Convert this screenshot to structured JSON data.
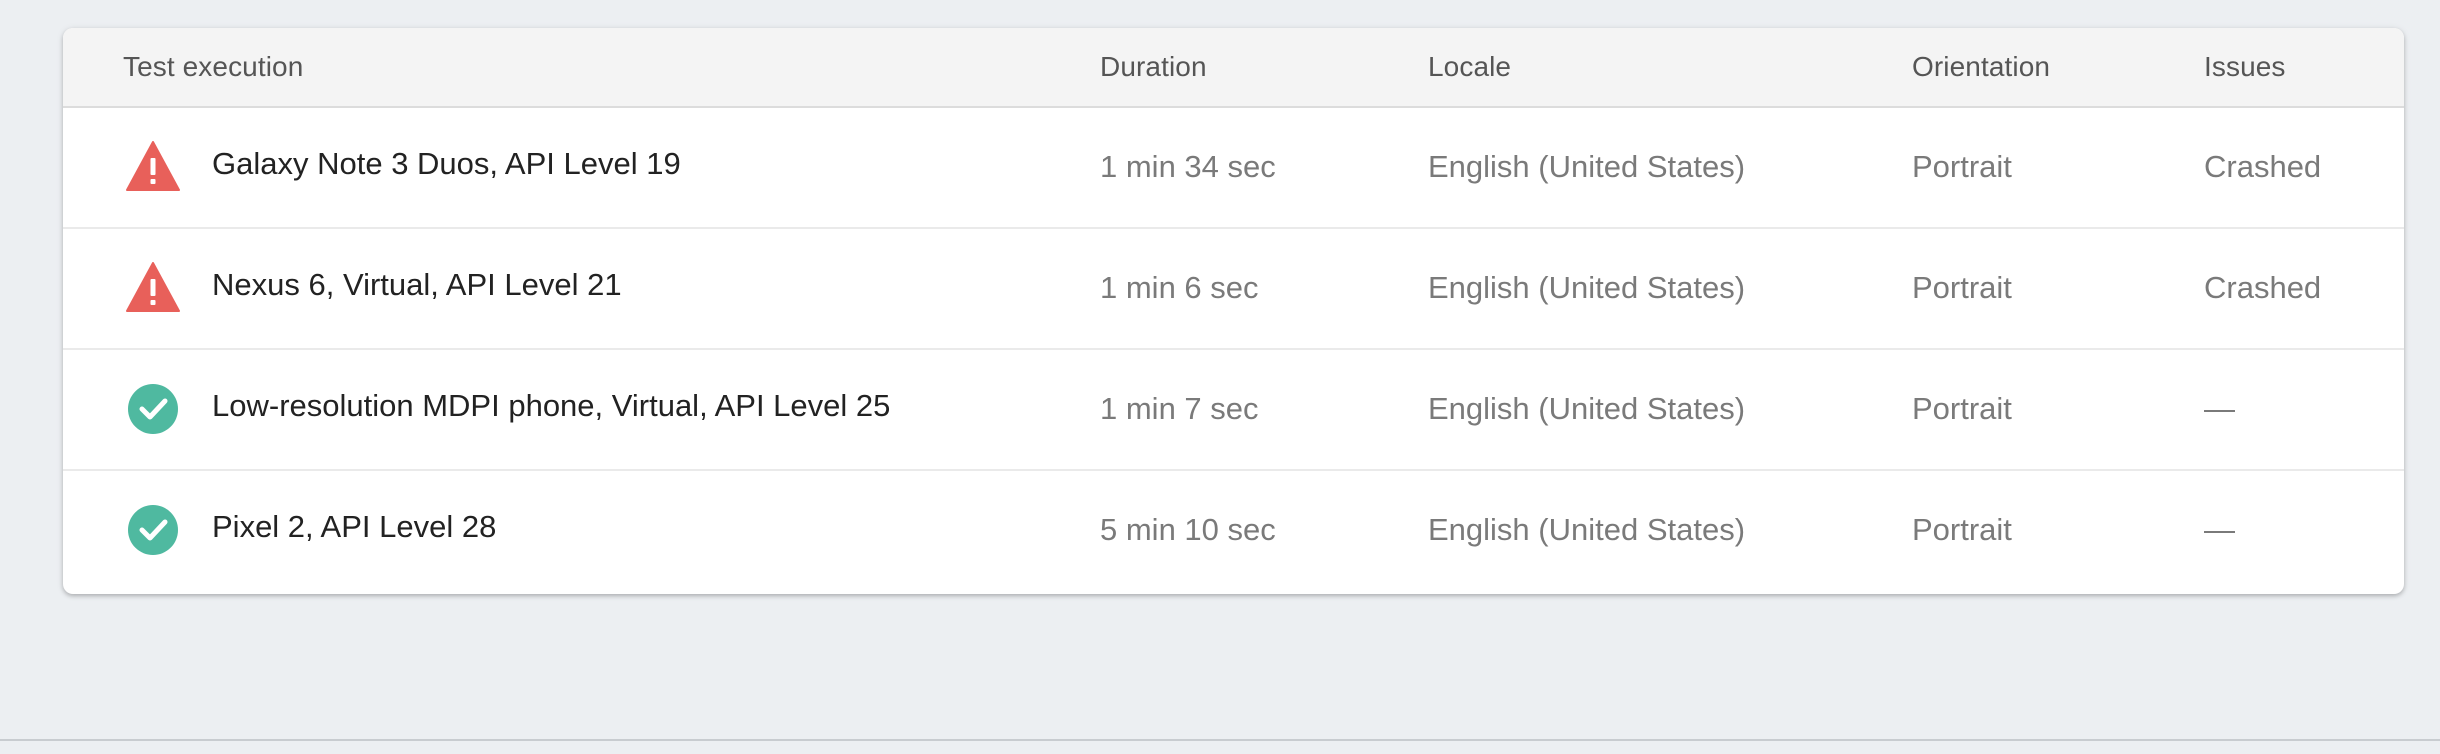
{
  "table": {
    "headers": {
      "test_execution": "Test execution",
      "duration": "Duration",
      "locale": "Locale",
      "orientation": "Orientation",
      "issues": "Issues"
    },
    "rows": [
      {
        "status_icon": "warning-triangle-icon",
        "status_color": "#e8605a",
        "name": "Galaxy Note 3 Duos, API Level 19",
        "duration": "1 min 34 sec",
        "locale": "English (United States)",
        "orientation": "Portrait",
        "issues": "Crashed"
      },
      {
        "status_icon": "warning-triangle-icon",
        "status_color": "#e8605a",
        "name": "Nexus 6, Virtual, API Level 21",
        "duration": "1 min 6 sec",
        "locale": "English (United States)",
        "orientation": "Portrait",
        "issues": "Crashed"
      },
      {
        "status_icon": "check-circle-icon",
        "status_color": "#4fb9a0",
        "name": "Low-resolution MDPI phone, Virtual, API Level 25",
        "duration": "1 min 7 sec",
        "locale": "English (United States)",
        "orientation": "Portrait",
        "issues": "—"
      },
      {
        "status_icon": "check-circle-icon",
        "status_color": "#4fb9a0",
        "name": "Pixel 2, API Level 28",
        "duration": "5 min 10 sec",
        "locale": "English (United States)",
        "orientation": "Portrait",
        "issues": "—"
      }
    ]
  }
}
